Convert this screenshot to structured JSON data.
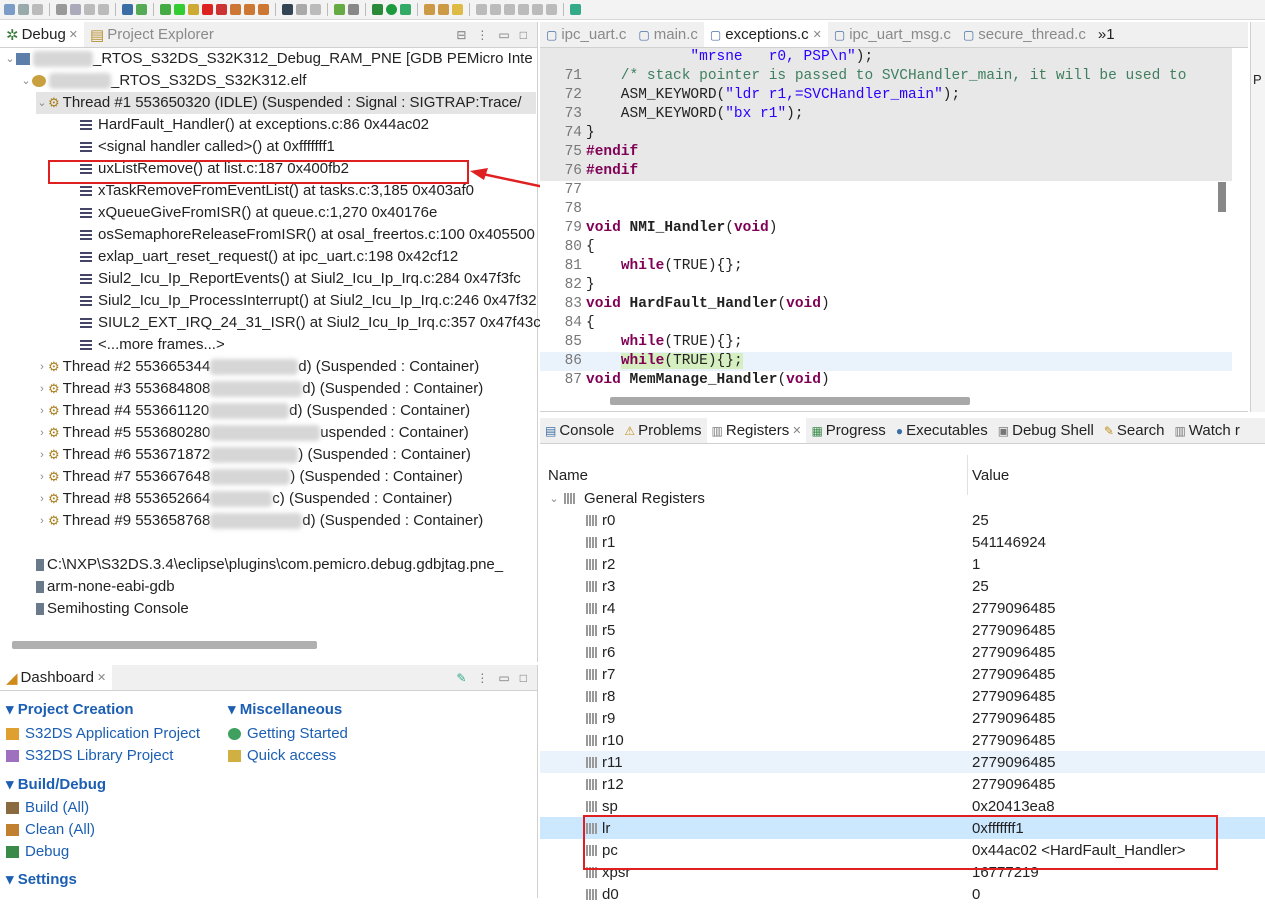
{
  "debug_view": {
    "tab_debug": "Debug",
    "tab_project_explorer": "Project Explorer",
    "launch": "_RTOS_S32DS_S32K312_Debug_RAM_PNE [GDB PEMicro Inte",
    "elf": "_RTOS_S32DS_S32K312.elf",
    "thread1": "Thread #1 553650320 (IDLE) (Suspended : Signal : SIGTRAP:Trace/",
    "frames": [
      "HardFault_Handler() at exceptions.c:86 0x44ac02",
      "<signal handler called>() at 0xfffffff1",
      "uxListRemove() at list.c:187 0x400fb2",
      "xTaskRemoveFromEventList() at tasks.c:3,185 0x403af0",
      "xQueueGiveFromISR() at queue.c:1,270 0x40176e",
      "osSemaphoreReleaseFromISR() at osal_freertos.c:100 0x405500",
      "exlap_uart_reset_request() at ipc_uart.c:198 0x42cf12",
      "Siul2_Icu_Ip_ReportEvents() at Siul2_Icu_Ip_Irq.c:284 0x47f3fc",
      "Siul2_Icu_Ip_ProcessInterrupt() at Siul2_Icu_Ip_Irq.c:246 0x47f32",
      "SIUL2_EXT_IRQ_24_31_ISR() at Siul2_Icu_Ip_Irq.c:357 0x47f43c",
      "<...more frames...>"
    ],
    "threads": [
      {
        "pre": "Thread #2 553665344 ",
        "post": "d) (Suspended : Container)"
      },
      {
        "pre": "Thread #3 553684808 ",
        "post": "d) (Suspended : Container)"
      },
      {
        "pre": "Thread #4 553661120",
        "post": "d) (Suspended : Container)"
      },
      {
        "pre": "Thread #5 553680280",
        "post": "uspended : Container)"
      },
      {
        "pre": "Thread #6 553671872 ",
        "post": ") (Suspended : Container)"
      },
      {
        "pre": "Thread #7 553667648 ",
        "post": ") (Suspended : Container)"
      },
      {
        "pre": "Thread #8 553652664",
        "post": "c) (Suspended : Container)"
      },
      {
        "pre": "Thread #9 553658768 ",
        "post": "d) (Suspended : Container)"
      }
    ],
    "process1": "C:\\NXP\\S32DS.3.4\\eclipse\\plugins\\com.pemicro.debug.gdbjtag.pne_",
    "process2": "arm-none-eabi-gdb",
    "process3": "Semihosting Console"
  },
  "dashboard": {
    "title": "Dashboard",
    "project_creation": "Project Creation",
    "app_project": "S32DS Application Project",
    "lib_project": "S32DS Library Project",
    "misc": "Miscellaneous",
    "getting_started": "Getting Started",
    "quick_access": "Quick access",
    "build_debug": "Build/Debug",
    "build": "Build  (All)",
    "clean": "Clean  (All)",
    "debug": "Debug",
    "settings": "Settings"
  },
  "editor": {
    "tabs": [
      "ipc_uart.c",
      "main.c",
      "exceptions.c",
      "ipc_uart_msg.c",
      "secure_thread.c"
    ],
    "overflow": "»1",
    "lines": [
      {
        "n": "",
        "t": "            \"mrsne   r0, PSP\\n\");"
      },
      {
        "n": "71",
        "t": "    /* stack pointer is passed to SVCHandler_main, it will be used to"
      },
      {
        "n": "72",
        "t": "    ASM_KEYWORD(\"ldr r1,=SVCHandler_main\");"
      },
      {
        "n": "73",
        "t": "    ASM_KEYWORD(\"bx r1\");"
      },
      {
        "n": "74",
        "t": "}"
      },
      {
        "n": "75",
        "t": "#endif"
      },
      {
        "n": "76",
        "t": "#endif"
      },
      {
        "n": "77",
        "t": ""
      },
      {
        "n": "78",
        "t": ""
      },
      {
        "n": "79",
        "t": "void NMI_Handler(void)"
      },
      {
        "n": "80",
        "t": "{"
      },
      {
        "n": "81",
        "t": "    while(TRUE){};"
      },
      {
        "n": "82",
        "t": "}"
      },
      {
        "n": "83",
        "t": "void HardFault_Handler(void)"
      },
      {
        "n": "84",
        "t": "{"
      },
      {
        "n": "85",
        "t": "    while(TRUE){};"
      },
      {
        "n": "86",
        "t": "}"
      },
      {
        "n": "87",
        "t": "void MemManage_Handler(void)"
      }
    ]
  },
  "registers_view": {
    "tabs": [
      "Console",
      "Problems",
      "Registers",
      "Progress",
      "Executables",
      "Debug Shell",
      "Search",
      "Watch r"
    ],
    "col_name": "Name",
    "col_value": "Value",
    "group": "General Registers",
    "rows": [
      {
        "name": "r0",
        "value": "25"
      },
      {
        "name": "r1",
        "value": "541146924"
      },
      {
        "name": "r2",
        "value": "1"
      },
      {
        "name": "r3",
        "value": "25"
      },
      {
        "name": "r4",
        "value": "2779096485"
      },
      {
        "name": "r5",
        "value": "2779096485"
      },
      {
        "name": "r6",
        "value": "2779096485"
      },
      {
        "name": "r7",
        "value": "2779096485"
      },
      {
        "name": "r8",
        "value": "2779096485"
      },
      {
        "name": "r9",
        "value": "2779096485"
      },
      {
        "name": "r10",
        "value": "2779096485"
      },
      {
        "name": "r11",
        "value": "2779096485"
      },
      {
        "name": "r12",
        "value": "2779096485"
      },
      {
        "name": "sp",
        "value": "0x20413ea8"
      },
      {
        "name": "lr",
        "value": "0xfffffff1"
      },
      {
        "name": "pc",
        "value": "0x44ac02 <HardFault_Handler>"
      },
      {
        "name": "xpsr",
        "value": "16777219"
      },
      {
        "name": "d0",
        "value": "0"
      }
    ]
  },
  "right_strip": {
    "label": "P"
  }
}
